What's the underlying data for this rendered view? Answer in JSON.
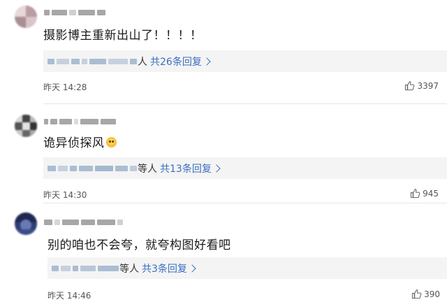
{
  "comments": [
    {
      "text": "摄影博主重新出山了！！！！",
      "reply_suffix": "人",
      "reply_link": "共26条回复",
      "time": "昨天 14:28",
      "likes": "3397"
    },
    {
      "text": "诡异侦探风",
      "emoji": "surprised-face-icon",
      "reply_suffix": "等人",
      "reply_link": "共13条回复",
      "time": "昨天 14:30",
      "likes": "945"
    },
    {
      "text": "别的咱也不会夸，就夸构图好看吧",
      "reply_suffix": "等人",
      "reply_link": "共3条回复",
      "time": "昨天 14:46",
      "likes": "390"
    }
  ],
  "colors": {
    "link": "#3a6fbf",
    "reply_bg": "#f4f4f4",
    "meta_text": "#555555"
  }
}
